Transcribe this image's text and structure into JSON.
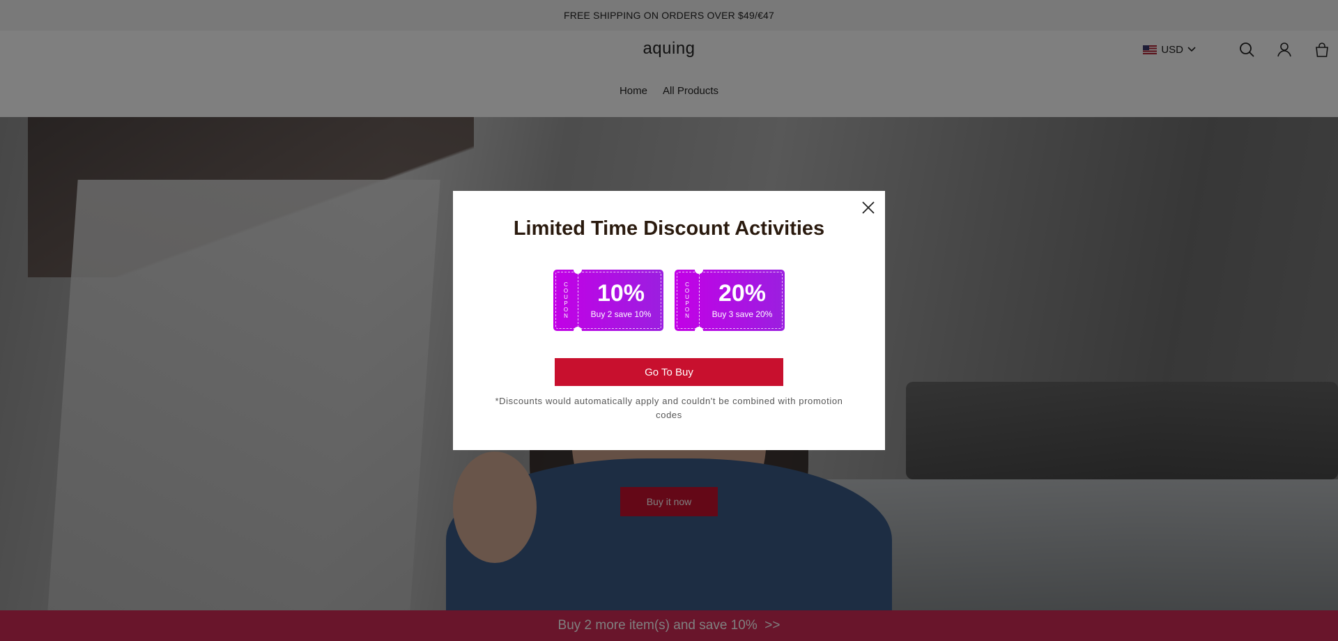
{
  "announcement": {
    "text": "FREE SHIPPING ON ORDERS OVER $49/€47"
  },
  "header": {
    "logo": "aquing",
    "currency": {
      "flag": "us-flag-icon",
      "code": "USD"
    },
    "icons": [
      "search-icon",
      "account-icon",
      "cart-icon"
    ],
    "nav": [
      {
        "label": "Home"
      },
      {
        "label": "All Products"
      }
    ]
  },
  "hero": {
    "button_label": "Buy it now"
  },
  "promo_bar": {
    "text": "Buy 2 more item(s) and save 10%  >>"
  },
  "modal": {
    "title": "Limited Time Discount Activities",
    "coupons": [
      {
        "stub": "COUPON",
        "percent": "10%",
        "description": "Buy 2 save 10%"
      },
      {
        "stub": "COUPON",
        "percent": "20%",
        "description": "Buy 3 save 20%"
      }
    ],
    "cta_label": "Go To Buy",
    "disclaimer": "*Discounts would automatically apply and couldn't be combined with promotion codes"
  },
  "colors": {
    "accent_red": "#c8102e",
    "promo_pink": "#d22a57",
    "coupon_start": "#c300e6",
    "coupon_end": "#9b1fe0"
  }
}
